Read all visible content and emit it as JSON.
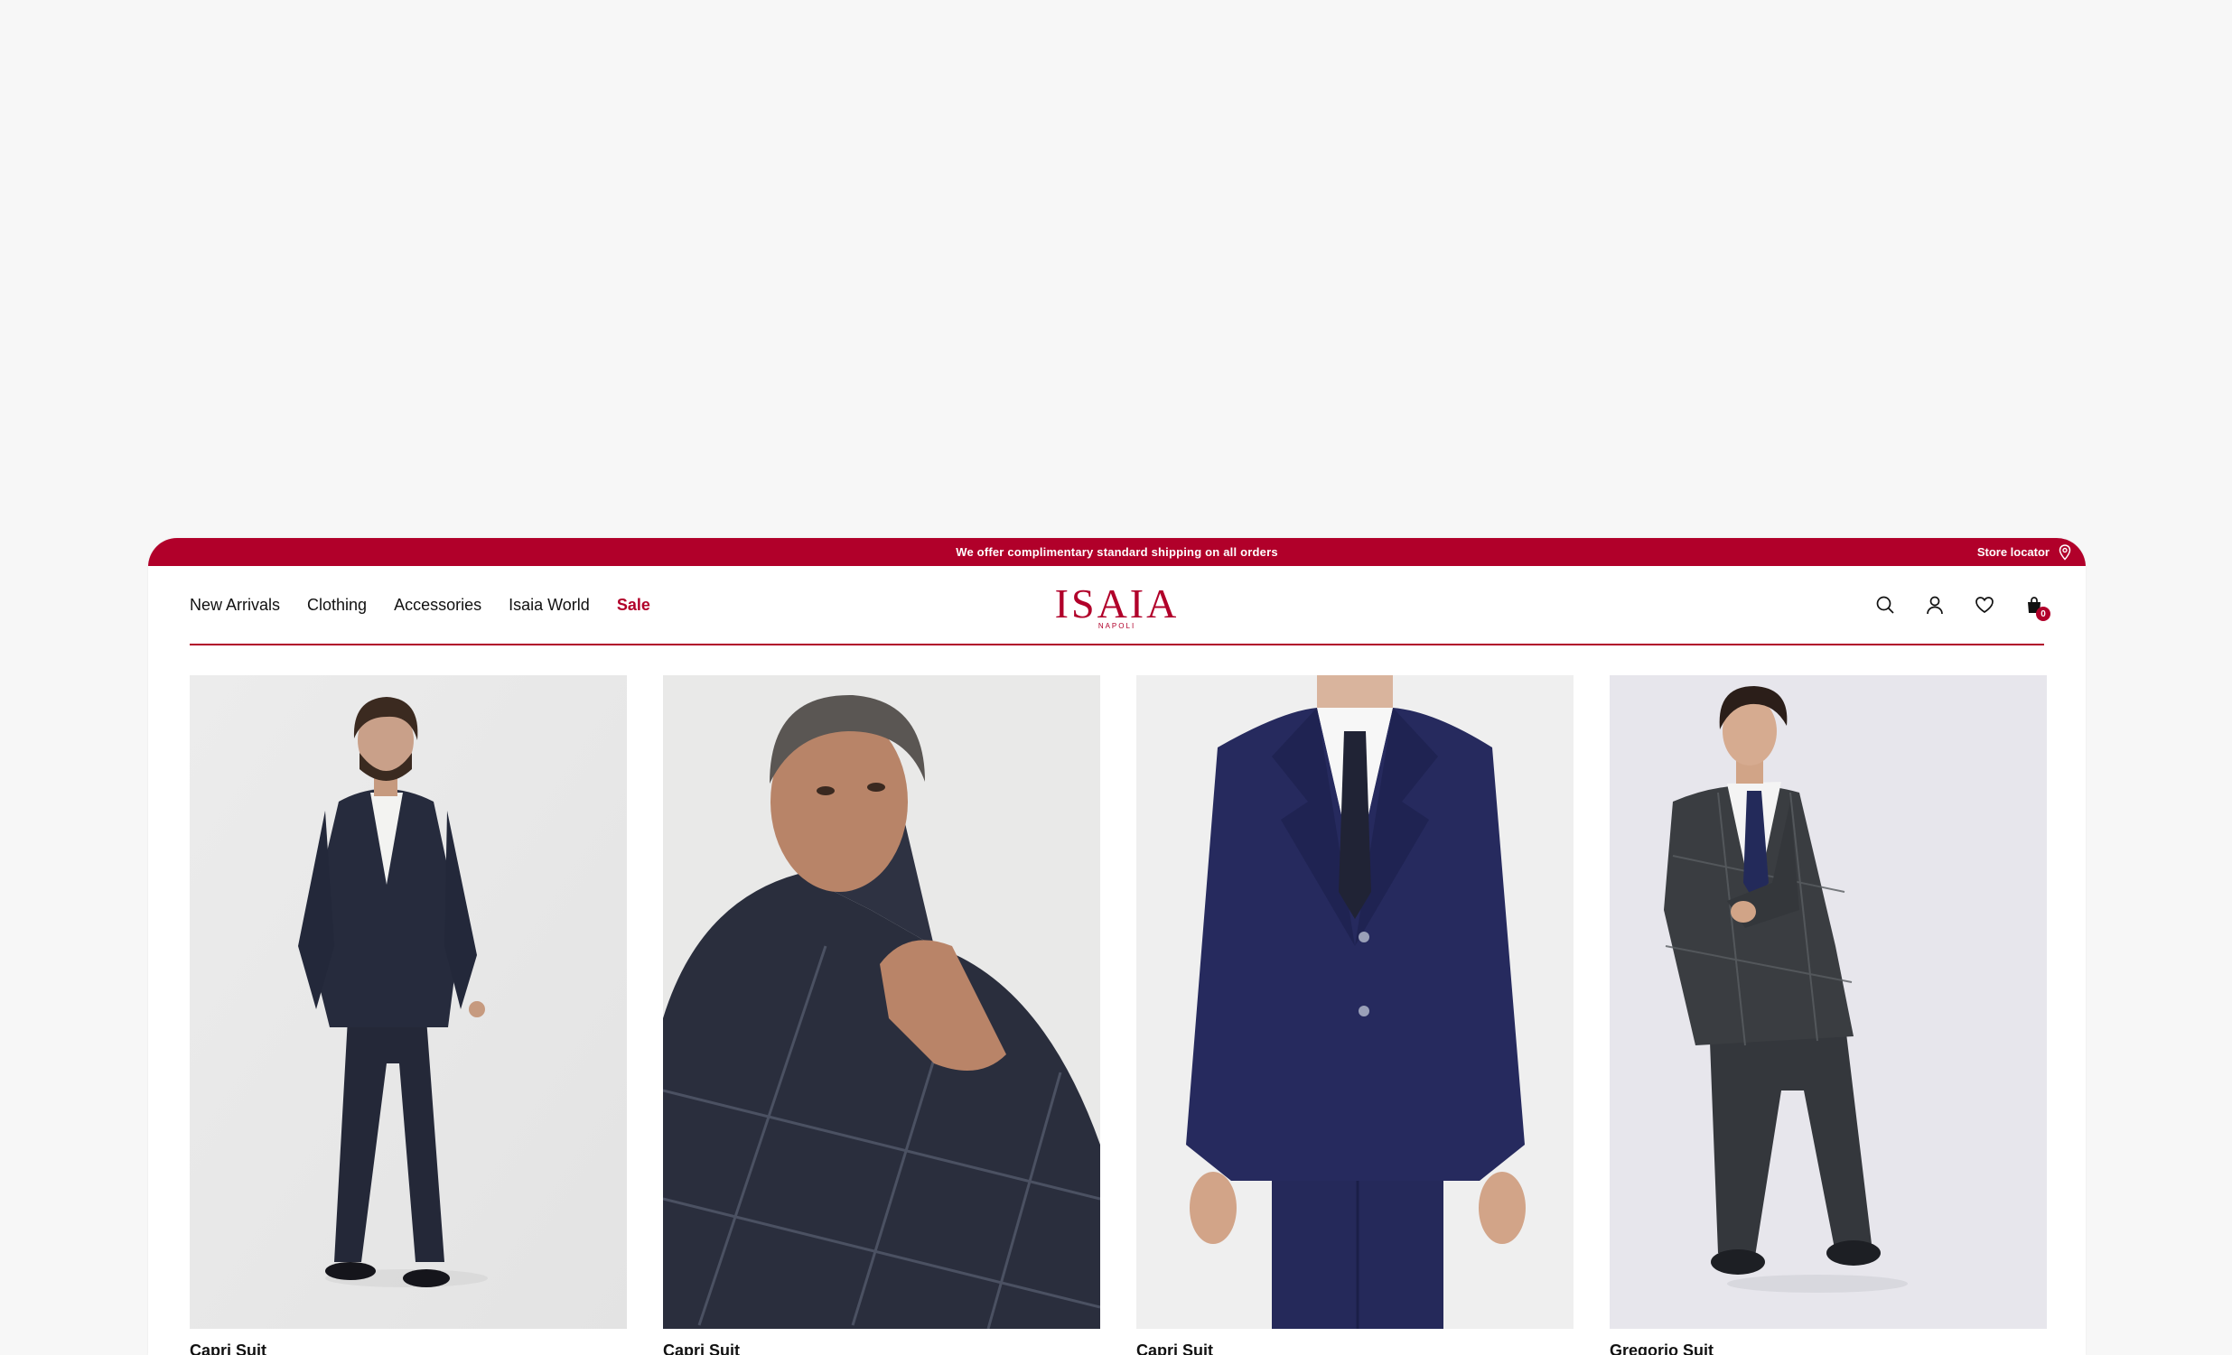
{
  "promo": {
    "message": "We offer complimentary standard shipping on all orders",
    "store_locator": "Store locator"
  },
  "nav": [
    {
      "label": "New Arrivals"
    },
    {
      "label": "Clothing"
    },
    {
      "label": "Accessories"
    },
    {
      "label": "Isaia World"
    },
    {
      "label": "Sale"
    }
  ],
  "logo": {
    "word": "ISAIA",
    "sub": "NAPOLI"
  },
  "cart": {
    "count": "0"
  },
  "products": [
    {
      "name": "Capri Suit"
    },
    {
      "name": "Capri Suit"
    },
    {
      "name": "Capri Suit"
    },
    {
      "name": "Gregorio Suit"
    }
  ],
  "colors": {
    "brand": "#b1002a",
    "background": "#f7f7f7"
  }
}
